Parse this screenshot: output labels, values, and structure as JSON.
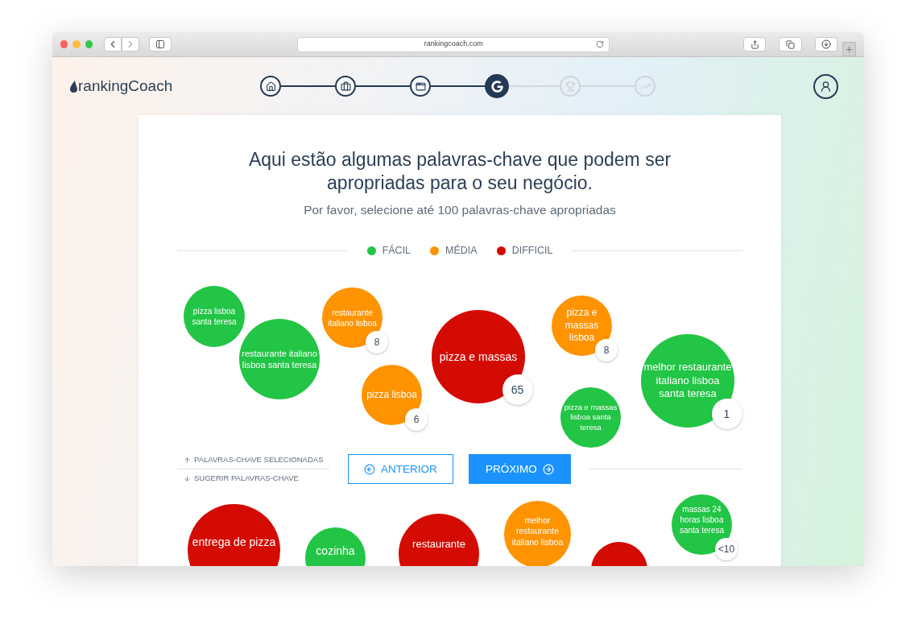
{
  "browser": {
    "url": "rankingcoach.com"
  },
  "header": {
    "logo": "rankingCoach",
    "steps": [
      {
        "done": true,
        "selected": false
      },
      {
        "done": true,
        "selected": false
      },
      {
        "done": true,
        "selected": false
      },
      {
        "done": false,
        "selected": true
      },
      {
        "done": false,
        "selected": false
      },
      {
        "done": false,
        "selected": false
      }
    ]
  },
  "card": {
    "title": "Aqui estão algumas palavras-chave que podem ser apropriadas para o seu negócio.",
    "subtitle": "Por favor, selecione até 100 palavras-chave apropriadas",
    "legend": [
      {
        "label": "FÁCIL",
        "color": "#22c545"
      },
      {
        "label": "MÉDIA",
        "color": "#ff9300"
      },
      {
        "label": "DIFFICIL",
        "color": "#d40b00"
      }
    ],
    "selected_keywords": [
      {
        "text": "pizza lisboa santa teresa",
        "color": "#22c545"
      },
      {
        "text": "restaurante italiano lisboa santa teresa",
        "color": "#22c545"
      },
      {
        "text": "restaurante italiano lisboa",
        "color": "#ff9300",
        "count": "8"
      },
      {
        "text": "pizza lisboa",
        "color": "#ff9300",
        "count": "6"
      },
      {
        "text": "pizza e massas",
        "color": "#d40b00",
        "count": "65"
      },
      {
        "text": "pizza e massas lisboa",
        "color": "#ff9300",
        "count": "8"
      },
      {
        "text": "pizza e massas lisboa santa teresa",
        "color": "#22c545"
      },
      {
        "text": "melhor restaurante italiano lisboa santa teresa",
        "color": "#22c545",
        "count": "1"
      }
    ],
    "links": [
      "PALAVRAS-CHAVE SELECIONADAS",
      "SUGERIR PALAVRAS-CHAVE"
    ],
    "back_button": "ANTERIOR",
    "next_button": "PRÓXIMO",
    "suggested_keywords": [
      {
        "text": "entrega de pizza",
        "color": "#d40b00"
      },
      {
        "text": "cozinha",
        "color": "#22c545"
      },
      {
        "text": "restaurante",
        "color": "#d40b00"
      },
      {
        "text": "melhor restaurante italiano lisboa",
        "color": "#ff9300"
      },
      {
        "color": "#d40b00"
      },
      {
        "text": "massas 24 horas lisboa santa teresa",
        "color": "#22c545",
        "count": "<10"
      }
    ]
  }
}
